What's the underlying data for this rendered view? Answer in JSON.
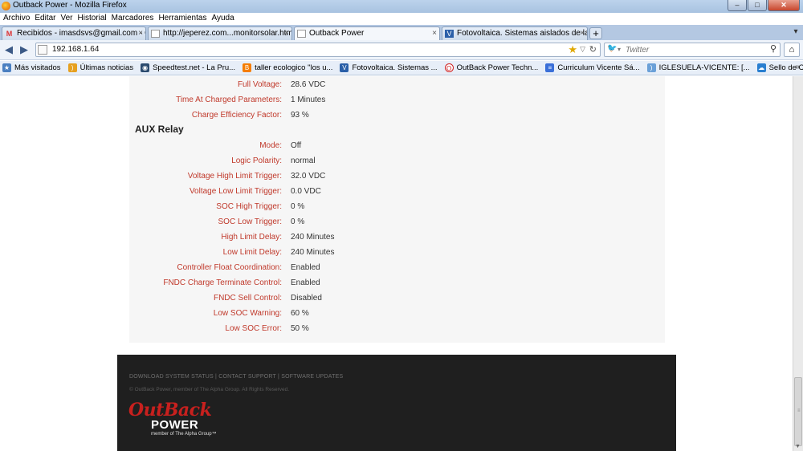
{
  "window": {
    "title": "Outback Power - Mozilla Firefox",
    "controls": [
      "–",
      "□",
      "✕"
    ]
  },
  "menu": [
    "Archivo",
    "Editar",
    "Ver",
    "Historial",
    "Marcadores",
    "Herramientas",
    "Ayuda"
  ],
  "tabs": [
    {
      "label": "Recibidos - imasdsvs@gmail.com - G...",
      "icon": "gmail-icon"
    },
    {
      "label": "http://jeperez.com...monitorsolar.html",
      "icon": "page-icon"
    },
    {
      "label": "Outback Power",
      "icon": "page-icon",
      "active": true
    },
    {
      "label": "Fotovoltaica. Sistemas aislados de la r...",
      "icon": "fotovoltaica-icon"
    }
  ],
  "nav": {
    "url": "192.168.1.64",
    "search_placeholder": "Twitter"
  },
  "bookmarks": [
    {
      "label": "Más visitados",
      "icon": "most-visited-icon",
      "color": "#4a7fc1"
    },
    {
      "label": "Últimas noticias",
      "icon": "rss-icon",
      "color": "#e6a020"
    },
    {
      "label": "Speedtest.net - La Pru...",
      "icon": "speedtest-icon",
      "color": "#2b4b6f"
    },
    {
      "label": "taller ecologico \"los u...",
      "icon": "blogger-icon",
      "color": "#f57d00"
    },
    {
      "label": "Fotovoltaica. Sistemas ...",
      "icon": "fotovoltaica-icon",
      "color": "#2a5fa8"
    },
    {
      "label": "OutBack Power Techn...",
      "icon": "outback-icon",
      "color": "#d02020"
    },
    {
      "label": "Curriculum Vicente Sá...",
      "icon": "document-icon",
      "color": "#3a6fd8"
    },
    {
      "label": "IGLESUELA-VICENTE: [...",
      "icon": "feed-icon",
      "color": "#6aa0d8"
    },
    {
      "label": "Sello de Calidad para P...",
      "icon": "seal-icon",
      "color": "#2a7fd0"
    }
  ],
  "charging_rows": [
    {
      "label": "Full Voltage:",
      "value": "28.6 VDC"
    },
    {
      "label": "Time At Charged Parameters:",
      "value": "1 Minutes"
    },
    {
      "label": "Charge Efficiency Factor:",
      "value": "93 %"
    }
  ],
  "aux_title": "AUX Relay",
  "aux_rows": [
    {
      "label": "Mode:",
      "value": "Off"
    },
    {
      "label": "Logic Polarity:",
      "value": "normal"
    },
    {
      "label": "Voltage High Limit Trigger:",
      "value": "32.0 VDC"
    },
    {
      "label": "Voltage Low Limit Trigger:",
      "value": "0.0 VDC"
    },
    {
      "label": "SOC High Trigger:",
      "value": "0 %"
    },
    {
      "label": "SOC Low Trigger:",
      "value": "0 %"
    },
    {
      "label": "High Limit Delay:",
      "value": "240 Minutes"
    },
    {
      "label": "Low Limit Delay:",
      "value": "240 Minutes"
    },
    {
      "label": "Controller Float Coordination:",
      "value": "Enabled"
    },
    {
      "label": "FNDC Charge Terminate Control:",
      "value": "Enabled"
    },
    {
      "label": "FNDC Sell Control:",
      "value": "Disabled"
    },
    {
      "label": "Low SOC Warning:",
      "value": "60 %"
    },
    {
      "label": "Low SOC Error:",
      "value": "50 %"
    }
  ],
  "footer": {
    "links": [
      "DOWNLOAD SYSTEM STATUS",
      "CONTACT SUPPORT",
      "SOFTWARE UPDATES"
    ],
    "separator": " | ",
    "copyright": "© OutBack Power, member of The Alpha Group. All Rights Reserved.",
    "logo_outback": "OutBack",
    "logo_power": "POWER",
    "logo_member": "member of The Alpha Group™"
  },
  "colors": {
    "label": "#c0392b",
    "footer_bg": "#1f1f1f",
    "panel_bg": "#f6f6f6"
  }
}
